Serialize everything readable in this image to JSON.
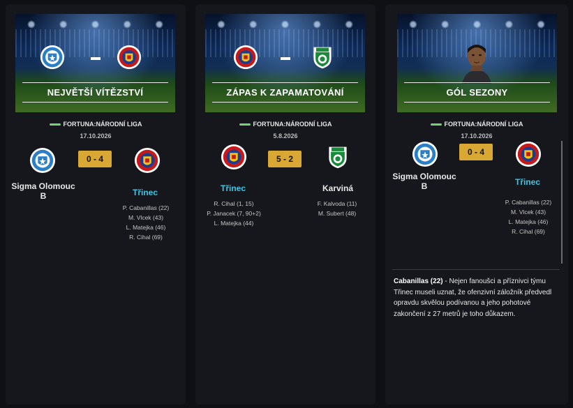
{
  "cards": [
    {
      "title": "NEJVĚTŠÍ VÍTĚZSTVÍ",
      "league": "FORTUNA:NÁRODNÍ LIGA",
      "date": "17.10.2026",
      "home": "Sigma Olomouc B",
      "away": "Třinec",
      "score": "0 - 4",
      "home_scorers": [],
      "away_scorers": [
        "P. Cabanillas (22)",
        "M. Vlcek (43)",
        "L. Matejka (46)",
        "R. Cihal (69)"
      ]
    },
    {
      "title": "ZÁPAS K ZAPAMATOVÁNÍ",
      "league": "FORTUNA:NÁRODNÍ LIGA",
      "date": "5.8.2026",
      "home": "Třinec",
      "away": "Karviná",
      "score": "5 - 2",
      "home_scorers": [
        "R. Cihal (1, 15)",
        "P. Janacek (7, 90+2)",
        "L. Matejka (44)"
      ],
      "away_scorers": [
        "F. Kalvoda (11)",
        "M. Subert (48)"
      ]
    },
    {
      "title": "GÓL SEZONY",
      "league": "FORTUNA:NÁRODNÍ LIGA",
      "date": "17.10.2026",
      "home": "Sigma Olomouc B",
      "away": "Třinec",
      "score": "0 - 4",
      "home_scorers": [],
      "away_scorers": [
        "P. Cabanillas (22)",
        "M. Vlcek (43)",
        "L. Matejka (46)",
        "R. Cihal (69)"
      ],
      "desc_name": "Cabanillas (22)",
      "desc_text": " - Nejen fanoušci a příznivci týmu Třinec museli uznat, že ofenzivní záložník předvedl opravdu skvělou podívanou a jeho pohotové zakončení z 27 metrů je toho důkazem."
    }
  ],
  "colors": {
    "accent": "#d8a734",
    "team_highlight": "#3cc6e6",
    "league_bar": "#7ad07a"
  },
  "icons": [
    "sigma-olomouc-crest-icon",
    "trinec-crest-icon",
    "karvina-crest-icon",
    "player-portrait-icon"
  ]
}
